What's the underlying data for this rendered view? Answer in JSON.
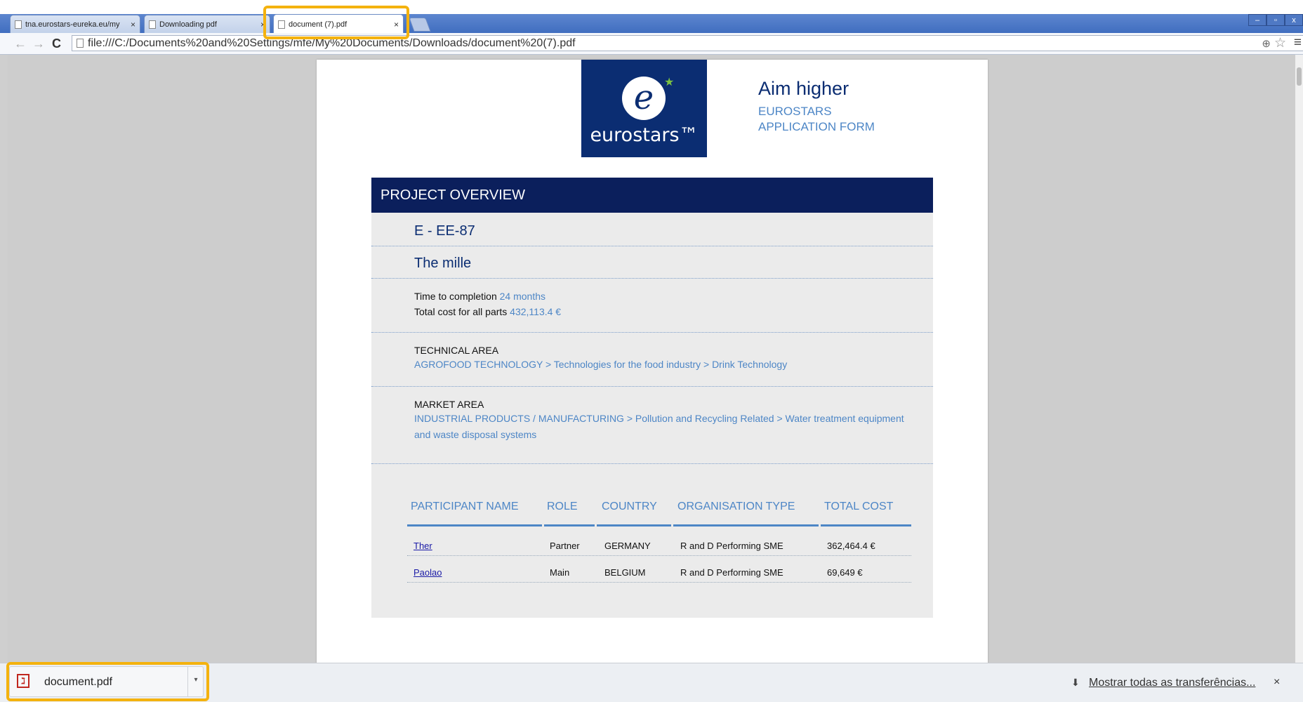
{
  "tabs": [
    {
      "title": "tna.eurostars-eureka.eu/my",
      "close": "×"
    },
    {
      "title": "Downloading pdf",
      "close": "×"
    },
    {
      "title": "document (7).pdf",
      "close": "×"
    }
  ],
  "window_controls": [
    "–",
    "▫",
    "x"
  ],
  "toolbar": {
    "back": "←",
    "forward": "→",
    "reload": "C",
    "url": "file:///C:/Documents%20and%20Settings/mfe/My%20Documents/Downloads/document%20(7).pdf"
  },
  "pdf": {
    "logo_text": "eurostars™",
    "logo_letter": "e",
    "tagline": "Aim higher",
    "app_line1": "EUROSTARS",
    "app_line2": "APPLICATION FORM",
    "section_title": "PROJECT OVERVIEW",
    "project_id": "E - EE-87",
    "project_name": "The mille",
    "time_label": "Time to completion",
    "time_value": "24 months",
    "cost_label": "Total cost for all parts",
    "cost_value": "432,113.4 €",
    "tech_label": "TECHNICAL AREA",
    "tech_value": "AGROFOOD TECHNOLOGY > Technologies for the food industry > Drink Technology",
    "market_label": "MARKET AREA",
    "market_value_line1": "INDUSTRIAL PRODUCTS / MANUFACTURING > Pollution and Recycling Related > Water treatment equipment",
    "market_value_line2": "and waste disposal systems",
    "table": {
      "headers": [
        "PARTICIPANT NAME",
        "ROLE",
        "COUNTRY",
        "ORGANISATION TYPE",
        "TOTAL COST"
      ],
      "rows": [
        [
          "Ther",
          "Partner",
          "GERMANY",
          "R and D Performing SME",
          "362,464.4 €"
        ],
        [
          "Paolao",
          "Main",
          "BELGIUM",
          "R and D Performing SME",
          "69,649 €"
        ]
      ]
    }
  },
  "download_shelf": {
    "file_name": "document.pdf",
    "show_all": "Mostrar todas as transferências...",
    "close": "×"
  },
  "colors": {
    "highlight": "#f4b20e",
    "brand_navy": "#0b2d72",
    "accent_blue": "#4d86c6"
  }
}
